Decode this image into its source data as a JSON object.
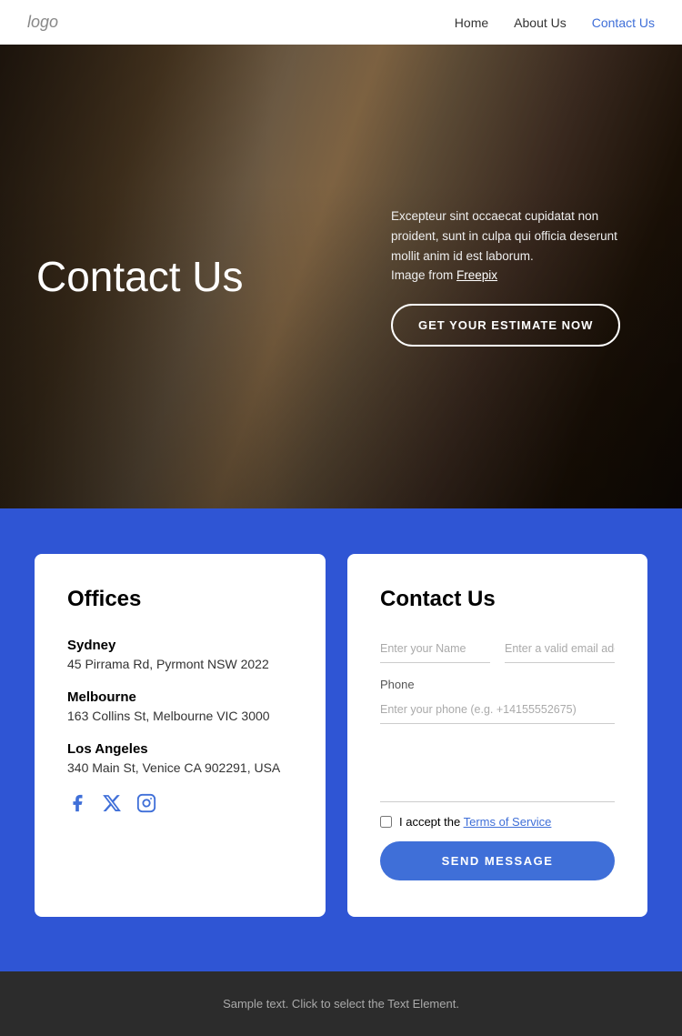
{
  "nav": {
    "logo": "logo",
    "links": [
      {
        "label": "Home",
        "active": false
      },
      {
        "label": "About Us",
        "active": false
      },
      {
        "label": "Contact Us",
        "active": true
      }
    ]
  },
  "hero": {
    "title": "Contact Us",
    "description": "Excepteur sint occaecat cupidatat non proident, sunt in culpa qui officia deserunt mollit anim id est laborum.",
    "image_credit_prefix": "Image from ",
    "image_credit_link": "Freepix",
    "cta_label": "GET YOUR ESTIMATE NOW"
  },
  "offices": {
    "section_title": "Offices",
    "locations": [
      {
        "city": "Sydney",
        "address": "45 Pirrama Rd, Pyrmont NSW 2022"
      },
      {
        "city": "Melbourne",
        "address": "163 Collins St, Melbourne VIC 3000"
      },
      {
        "city": "Los Angeles",
        "address": "340 Main St, Venice CA 902291, USA"
      }
    ],
    "social": {
      "facebook": "f",
      "twitter": "𝕏",
      "instagram": "⬡"
    }
  },
  "contact_form": {
    "title": "Contact Us",
    "name_placeholder": "Enter your Name",
    "email_placeholder": "Enter a valid email address",
    "phone_label": "Phone",
    "phone_placeholder": "Enter your phone (e.g. +14155552675)",
    "terms_prefix": "I accept the ",
    "terms_link": "Terms of Service",
    "send_label": "SEND MESSAGE"
  },
  "footer": {
    "text": "Sample text. Click to select the Text Element."
  }
}
